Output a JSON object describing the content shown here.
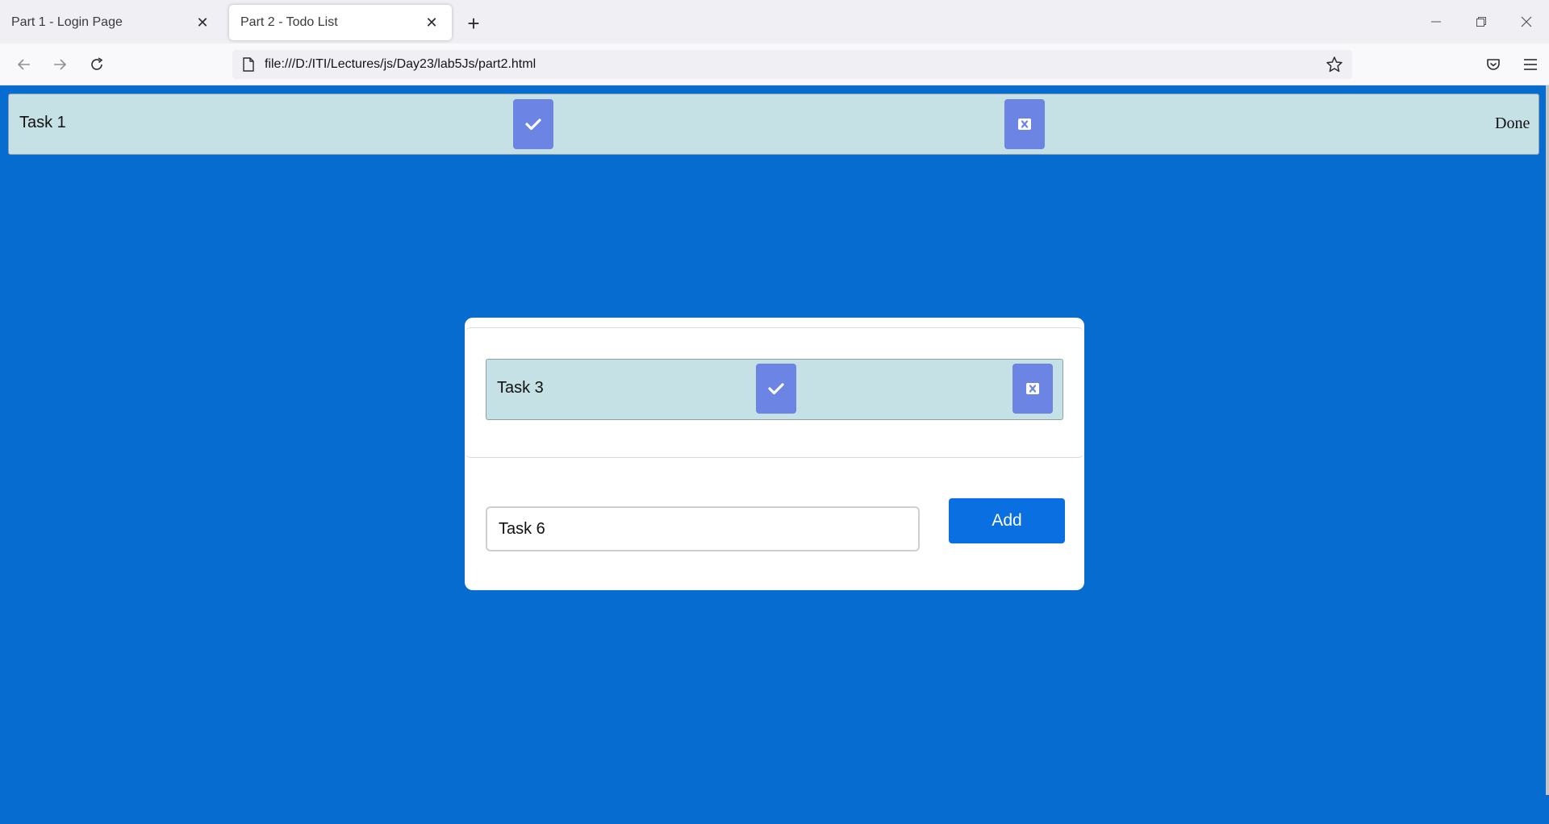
{
  "browser": {
    "tabs": [
      {
        "title": "Part 1 - Login Page",
        "active": false
      },
      {
        "title": "Part 2 - Todo List",
        "active": true
      }
    ],
    "url": "file:///D:/ITI/Lectures/js/Day23/lab5Js/part2.html"
  },
  "page": {
    "background_color": "#066ccf",
    "done_tasks": [
      {
        "label": "Task 1",
        "status_label": "Done"
      }
    ],
    "pending_tasks": [
      {
        "label": "Task 3"
      }
    ],
    "new_task_input": {
      "value": "Task 6"
    },
    "add_button_label": "Add"
  },
  "colors": {
    "task_row_bg": "#c5e1e5",
    "icon_button_bg": "#6c84e4",
    "add_button_bg": "#0a6fe0"
  },
  "icons": {
    "complete": "check-icon",
    "delete": "square-x-icon"
  }
}
